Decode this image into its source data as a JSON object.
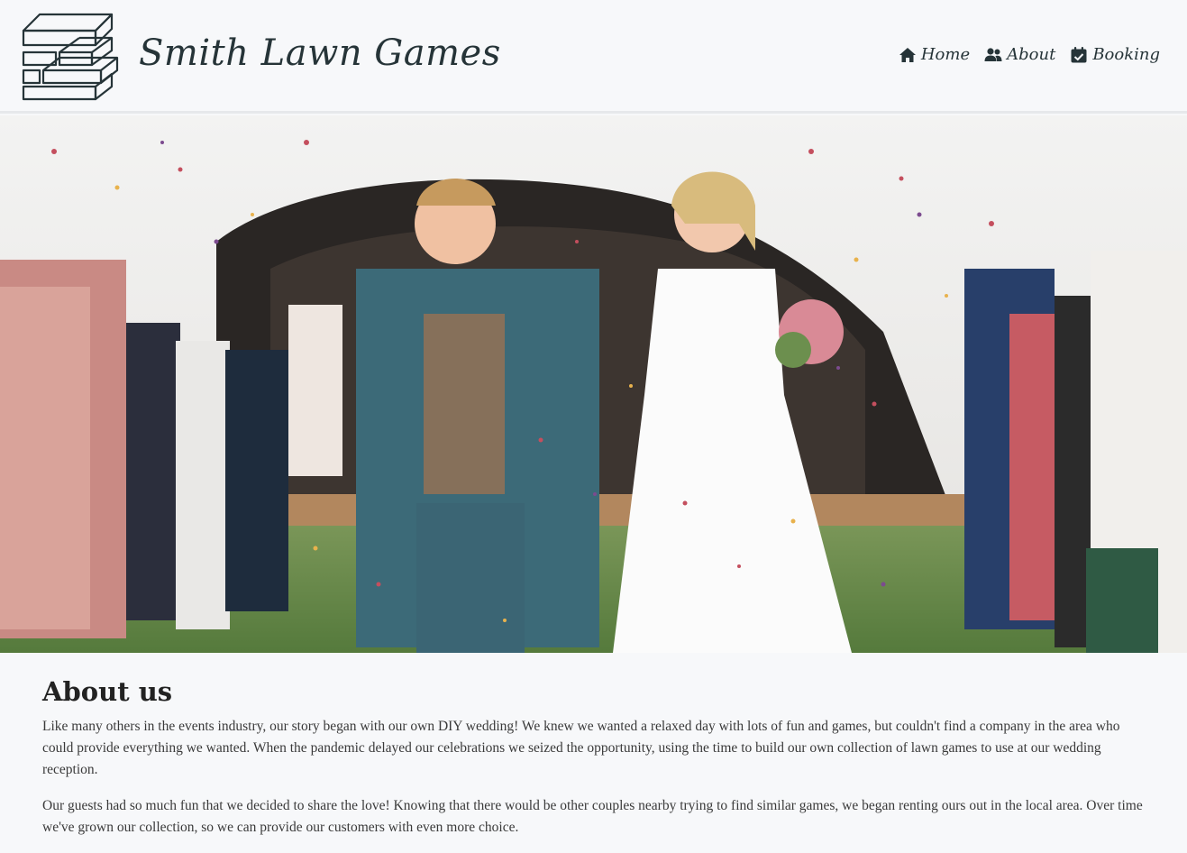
{
  "header": {
    "brand": "Smith Lawn Games",
    "nav": [
      {
        "label": "Home",
        "icon": "home-icon"
      },
      {
        "label": "About",
        "icon": "users-icon"
      },
      {
        "label": "Booking",
        "icon": "calendar-check-icon"
      }
    ]
  },
  "hero": {
    "alt": "Bride and groom walking through confetti at their wedding reception"
  },
  "about": {
    "heading": "About us",
    "paragraphs": [
      "Like many others in the events industry, our story began with our own DIY wedding! We knew we wanted a relaxed day with lots of fun and games, but couldn't find a company in the area who could provide everything we wanted. When the pandemic delayed our celebrations we seized the opportunity, using the time to build our own collection of lawn games to use at our wedding reception.",
      "Our guests had so much fun that we decided to share the love! Knowing that there would be other couples nearby trying to find similar games, we began renting ours out in the local area. Over time we've grown our collection, so we can provide our customers with even more choice."
    ]
  },
  "colors": {
    "brand_text": "#263438",
    "background": "#f7f8fa",
    "divider": "#e6e8eb"
  }
}
